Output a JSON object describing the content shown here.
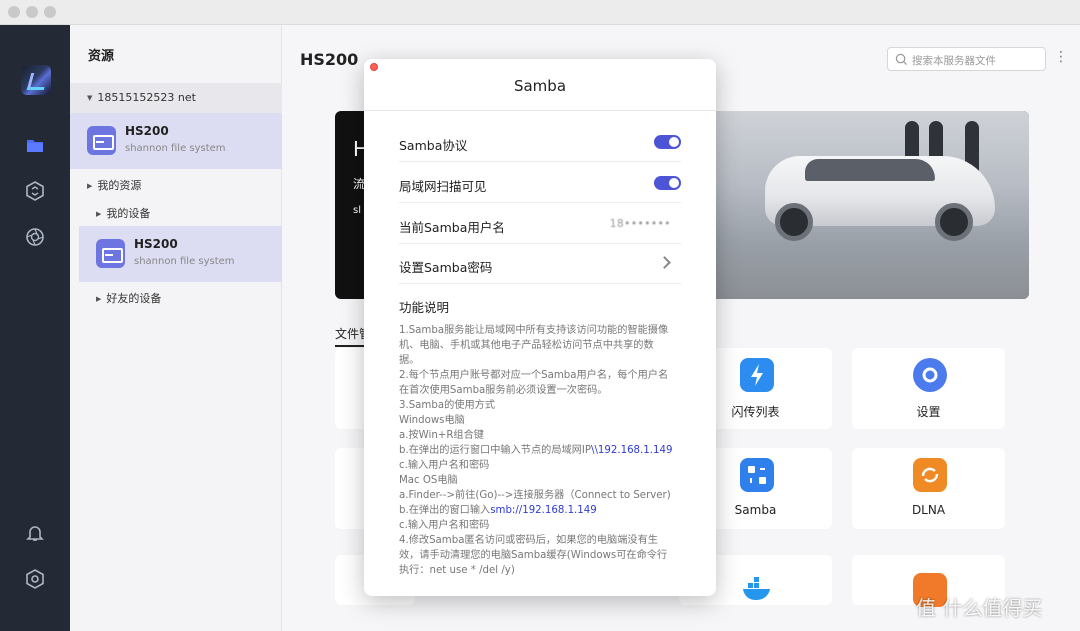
{
  "app": {
    "window_controls": [
      "close",
      "minimize",
      "zoom"
    ]
  },
  "rail": {
    "icons": [
      "app-logo",
      "folder-icon",
      "sync-icon",
      "aperture-icon",
      "bell-icon",
      "settings-icon"
    ]
  },
  "sidebar": {
    "title": "资源",
    "account": "18515152523 net",
    "devices": [
      {
        "name": "HS200",
        "subtitle": "shannon file system"
      },
      {
        "name": "HS200",
        "subtitle": "shannon file system"
      }
    ],
    "tree": {
      "my_resources": "我的资源",
      "my_devices": "我的设备",
      "friend_devices": "好友的设备"
    }
  },
  "main": {
    "title": "HS200",
    "search_placeholder": "搜索本服务器文件",
    "more": "⋮",
    "banner": {
      "line1": "H",
      "line2": "流",
      "line3": "sl"
    },
    "tab_label": "文件管理",
    "tiles": [
      {
        "label": "闪传列表",
        "icon": "flash-icon",
        "color": "#2d8cf0"
      },
      {
        "label": "设置",
        "icon": "settings-hex-icon",
        "color": "#4b7bec"
      },
      {
        "label": "Samba",
        "icon": "samba-icon",
        "color": "#2f80ed"
      },
      {
        "label": "DLNA",
        "icon": "dlna-icon",
        "color": "#f08a24"
      },
      {
        "label": "",
        "icon": "docker-icon",
        "color": "#2496ed"
      },
      {
        "label": "",
        "icon": "download-icon",
        "color": "#f07a2a"
      }
    ]
  },
  "modal": {
    "title": "Samba",
    "rows": [
      {
        "label": "Samba协议",
        "type": "toggle",
        "on": true
      },
      {
        "label": "局域网扫描可见",
        "type": "toggle",
        "on": true
      },
      {
        "label": "当前Samba用户名",
        "type": "value",
        "value": "18•••••••"
      },
      {
        "label": "设置Samba密码",
        "type": "link"
      }
    ],
    "func_title": "功能说明",
    "func_lines": [
      {
        "text": "1.Samba服务能让局域网中所有支持该访问功能的智能摄像"
      },
      {
        "text": "机、电脑、手机或其他电子产品轻松访问节点中共享的数"
      },
      {
        "text": "据。"
      },
      {
        "text": "2.每个节点用户账号都对应一个Samba用户名，每个用户名"
      },
      {
        "text": "在首次使用Samba服务前必须设置一次密码。"
      },
      {
        "text": "3.Samba的使用方式"
      },
      {
        "text": "Windows电脑"
      },
      {
        "text": "a.按Win+R组合键"
      },
      {
        "text": "b.在弹出的运行窗口中输入节点的局域网IP",
        "link": "\\\\192.168.1.149"
      },
      {
        "text": "c.输入用户名和密码"
      },
      {
        "text": "Mac OS电脑"
      },
      {
        "text": "a.Finder-->前往(Go)-->连接服务器（Connect to Server)"
      },
      {
        "text": "b.在弹出的窗口输入",
        "link": "smb://192.168.1.149"
      },
      {
        "text": "c.输入用户名和密码"
      },
      {
        "text": "4.修改Samba匿名访问或密码后，如果您的电脑端没有生"
      },
      {
        "text": "效，请手动清理您的电脑Samba缓存(Windows可在命令行"
      },
      {
        "text": "执行：net use * /del /y)"
      }
    ]
  },
  "watermark": "值 什么值得买"
}
